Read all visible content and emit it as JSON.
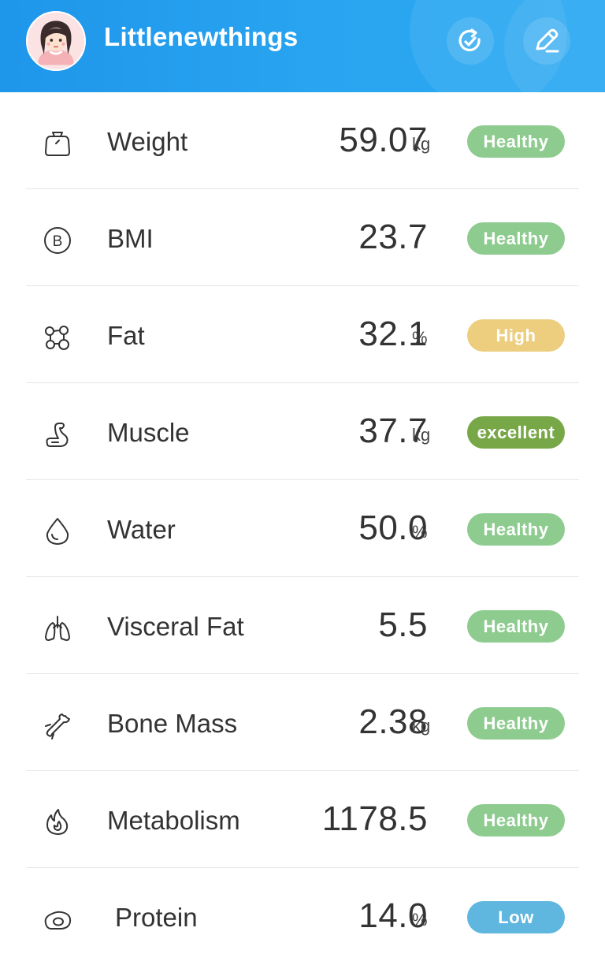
{
  "header": {
    "username": "Littlenewthings",
    "avatar_icon": "avatar-girl-icon",
    "refresh_icon": "refresh-icon",
    "edit_icon": "edit-pencil-icon",
    "background_color": "#2196f3"
  },
  "colors": {
    "healthy": "#8dcb8f",
    "high": "#edce7f",
    "excellent": "#78a748",
    "low": "#5fb6de",
    "divider": "#e6e6e6"
  },
  "metrics": [
    {
      "icon": "scale-icon",
      "label": "Weight",
      "value": "59.07",
      "unit": "kg",
      "status": "Healthy",
      "status_color": "#8dcb8f"
    },
    {
      "icon": "bmi-icon",
      "label": "BMI",
      "value": "23.7",
      "unit": "",
      "status": "Healthy",
      "status_color": "#8dcb8f"
    },
    {
      "icon": "fat-icon",
      "label": "Fat",
      "value": "32.1",
      "unit": "%",
      "status": "High",
      "status_color": "#edce7f"
    },
    {
      "icon": "muscle-icon",
      "label": "Muscle",
      "value": "37.7",
      "unit": "kg",
      "status": "excellent",
      "status_color": "#78a748"
    },
    {
      "icon": "water-drop-icon",
      "label": "Water",
      "value": "50.0",
      "unit": "%",
      "status": "Healthy",
      "status_color": "#8dcb8f"
    },
    {
      "icon": "lungs-icon",
      "label": "Visceral Fat",
      "value": "5.5",
      "unit": "",
      "status": "Healthy",
      "status_color": "#8dcb8f"
    },
    {
      "icon": "bone-icon",
      "label": "Bone Mass",
      "value": "2.38",
      "unit": "kg",
      "status": "Healthy",
      "status_color": "#8dcb8f"
    },
    {
      "icon": "flame-icon",
      "label": "Metabolism",
      "value": "1178.5",
      "unit": "",
      "status": "Healthy",
      "status_color": "#8dcb8f"
    },
    {
      "icon": "egg-icon",
      "label": "Protein",
      "value": "14.0",
      "unit": "%",
      "status": "Low",
      "status_color": "#5fb6de"
    }
  ]
}
